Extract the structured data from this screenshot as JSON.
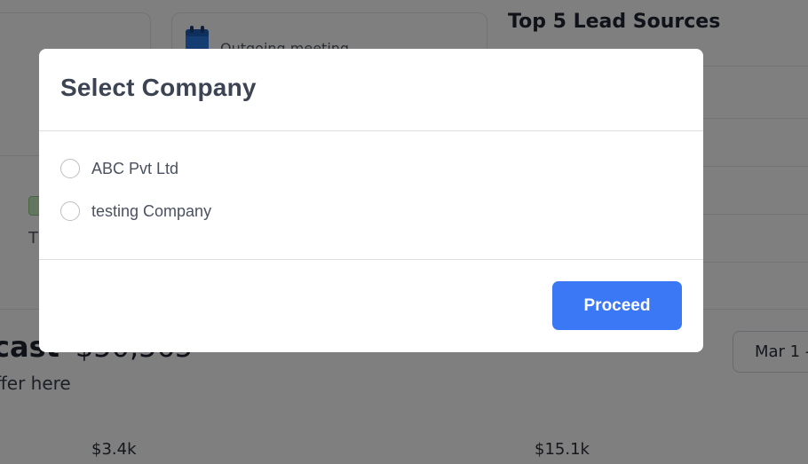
{
  "background": {
    "meeting_card_label": "Outgoing meeting",
    "partial_text": "T",
    "lead_sources_title": "Top 5 Lead Sources",
    "forecast_title": "cast",
    "forecast_amount": "$50,565",
    "offer_text": "ffer here",
    "date_range_label": "Mar 1 -",
    "tick_labels": [
      "$3.4k",
      "$15.1k"
    ],
    "icon_names": [
      "calendar-icon"
    ]
  },
  "modal": {
    "title": "Select Company",
    "options": [
      {
        "label": "ABC Pvt Ltd",
        "selected": false
      },
      {
        "label": "testing Company",
        "selected": false
      }
    ],
    "proceed_label": "Proceed"
  },
  "colors": {
    "primary_button": "#3b78f6",
    "overlay": "rgba(0,0,0,0.5)",
    "title_text": "#3c4453"
  }
}
